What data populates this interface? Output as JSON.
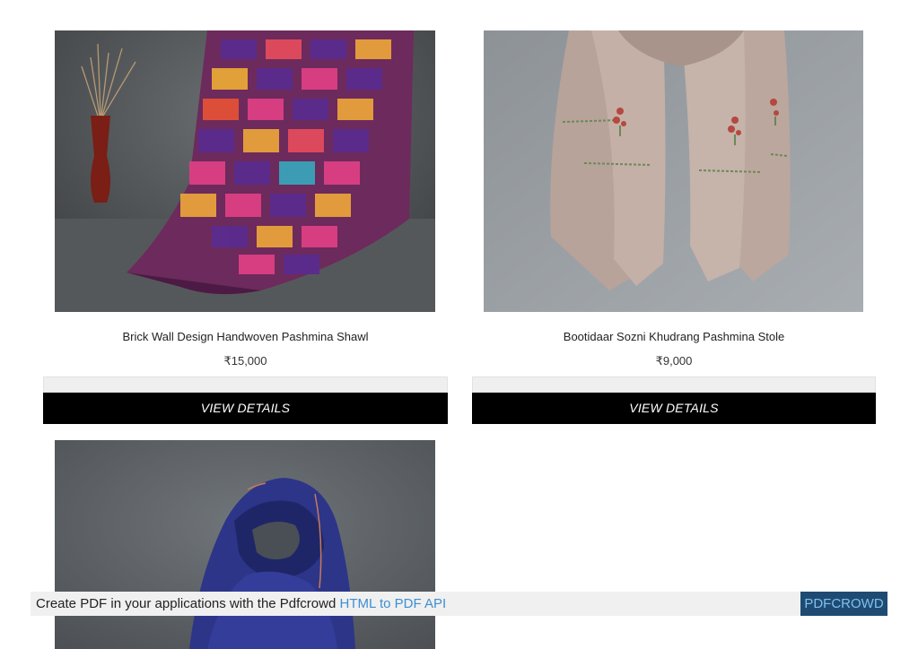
{
  "products": [
    {
      "title": "Brick Wall Design Handwoven Pashmina Shawl",
      "price": "₹15,000",
      "button_label": "VIEW DETAILS",
      "image": "purple-multicolor-check-shawl-on-chair"
    },
    {
      "title": "Bootidaar Sozni Khudrang Pashmina Stole",
      "price": "₹9,000",
      "button_label": "VIEW DETAILS",
      "image": "beige-embroidered-stole-hanging"
    },
    {
      "image": "navy-blue-pashmina-draped"
    }
  ],
  "pdf_banner": {
    "text": "Create PDF in your applications with the Pdfcrowd ",
    "link_text": "HTML to PDF API",
    "badge": "PDFCROWD"
  },
  "colors": {
    "button_bg": "#000000",
    "band_bg": "#efefef",
    "badge_bg": "#1f4b73",
    "link": "#3e8fd1"
  }
}
